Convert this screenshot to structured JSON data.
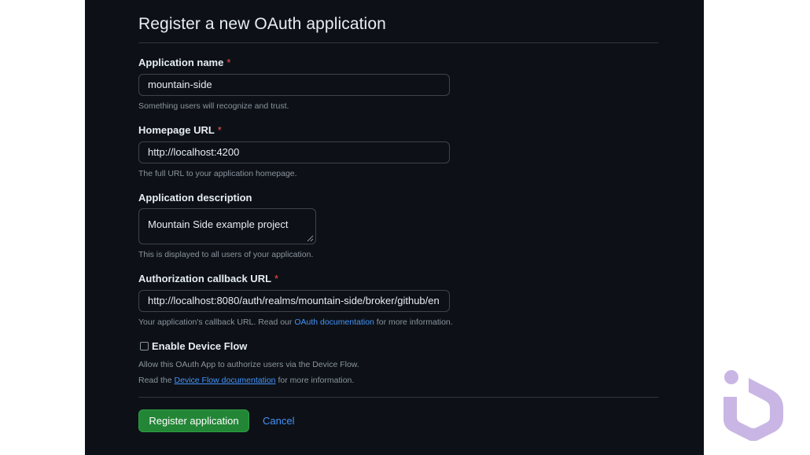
{
  "form": {
    "title": "Register a new OAuth application",
    "app_name": {
      "label": "Application name",
      "required": "*",
      "value": "mountain-side",
      "note": "Something users will recognize and trust."
    },
    "homepage": {
      "label": "Homepage URL",
      "required": "*",
      "value": "http://localhost:4200",
      "note": "The full URL to your application homepage."
    },
    "description": {
      "label": "Application description",
      "value": "Mountain Side example project",
      "note": "This is displayed to all users of your application."
    },
    "callback": {
      "label": "Authorization callback URL",
      "required": "*",
      "value": "http://localhost:8080/auth/realms/mountain-side/broker/github/en",
      "note_prefix": "Your application's callback URL. Read our ",
      "note_link": "OAuth documentation",
      "note_suffix": " for more information."
    },
    "device_flow": {
      "label": "Enable Device Flow",
      "checked": false,
      "note1": "Allow this OAuth App to authorize users via the Device Flow.",
      "note2_prefix": "Read the ",
      "note2_link": "Device Flow documentation",
      "note2_suffix": " for more information."
    },
    "submit_label": "Register application",
    "cancel_label": "Cancel"
  },
  "colors": {
    "background": "#0d1117",
    "primary_button": "#238636",
    "link": "#4493f8",
    "required": "#f85149",
    "brand_logo": "#c9b6e4"
  },
  "icons": {
    "brand": "hexagon-logo-icon",
    "resize": "resize-grip-icon",
    "checkbox": "checkbox-unchecked-icon"
  }
}
